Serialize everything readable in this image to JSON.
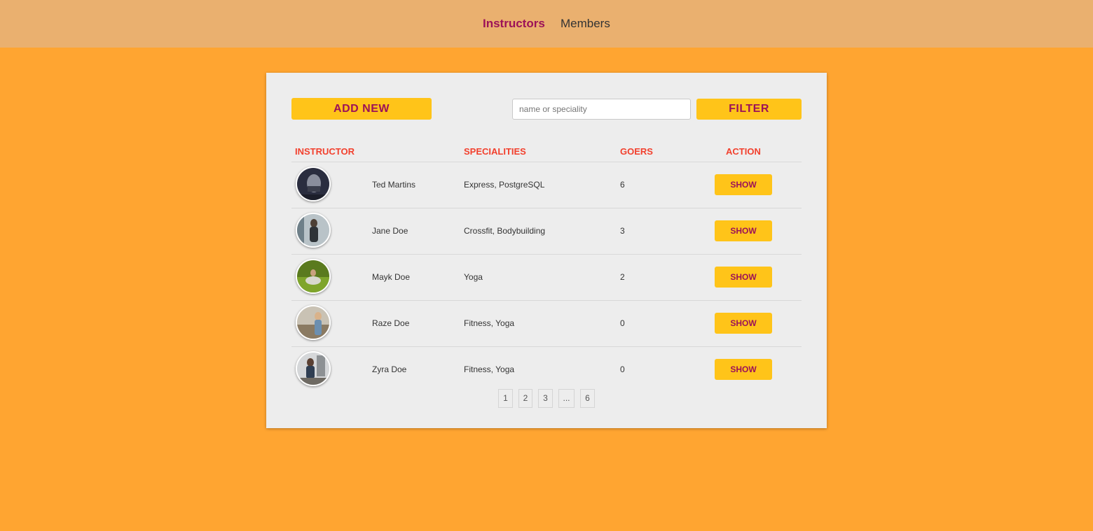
{
  "nav": {
    "instructors": "Instructors",
    "members": "Members"
  },
  "toolbar": {
    "add_label": "ADD NEW",
    "search_placeholder": "name or speciality",
    "filter_label": "FILTER"
  },
  "table": {
    "headers": {
      "instructor": "INSTRUCTOR",
      "specialities": "SPECIALITIES",
      "goers": "GOERS",
      "action": "ACTION"
    },
    "rows": [
      {
        "name": "Ted Martins",
        "specialities": "Express, PostgreSQL",
        "goers": "6",
        "action": "SHOW"
      },
      {
        "name": "Jane Doe",
        "specialities": "Crossfit, Bodybuilding",
        "goers": "3",
        "action": "SHOW"
      },
      {
        "name": "Mayk Doe",
        "specialities": "Yoga",
        "goers": "2",
        "action": "SHOW"
      },
      {
        "name": "Raze Doe",
        "specialities": "Fitness, Yoga",
        "goers": "0",
        "action": "SHOW"
      },
      {
        "name": "Zyra Doe",
        "specialities": "Fitness, Yoga",
        "goers": "0",
        "action": "SHOW"
      }
    ]
  },
  "pagination": [
    "1",
    "2",
    "3",
    "...",
    "6"
  ],
  "colors": {
    "background": "#ffa531",
    "topbar": "#eab06f",
    "card": "#ededed",
    "button": "#ffc419",
    "button_text": "#9c1258",
    "header_text": "#f2402d",
    "active_nav": "#9c1258"
  }
}
